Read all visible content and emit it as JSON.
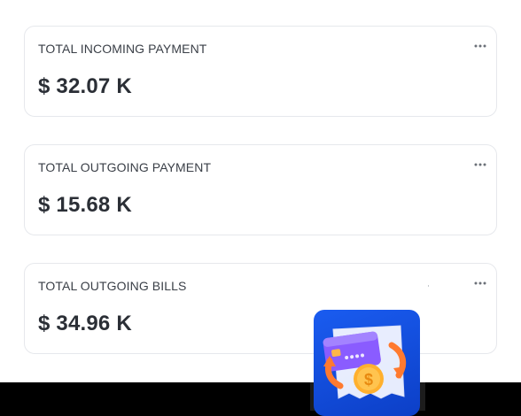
{
  "cards": [
    {
      "title": "TOTAL INCOMING PAYMENT",
      "value": "$ 32.07 K"
    },
    {
      "title": "TOTAL OUTGOING PAYMENT",
      "value": "$ 15.68 K"
    },
    {
      "title": "TOTAL OUTGOING BILLS",
      "value": "$ 34.96 K"
    }
  ],
  "icons": {
    "more": "more-dots-icon",
    "app": "card-payment-exchange-icon"
  },
  "colors": {
    "card_border": "#e6e8ec",
    "title_text": "#3a3f47",
    "value_text": "#2b2f36",
    "icon_bg": "#1a5cf0",
    "bottom_bar": "#000000"
  }
}
